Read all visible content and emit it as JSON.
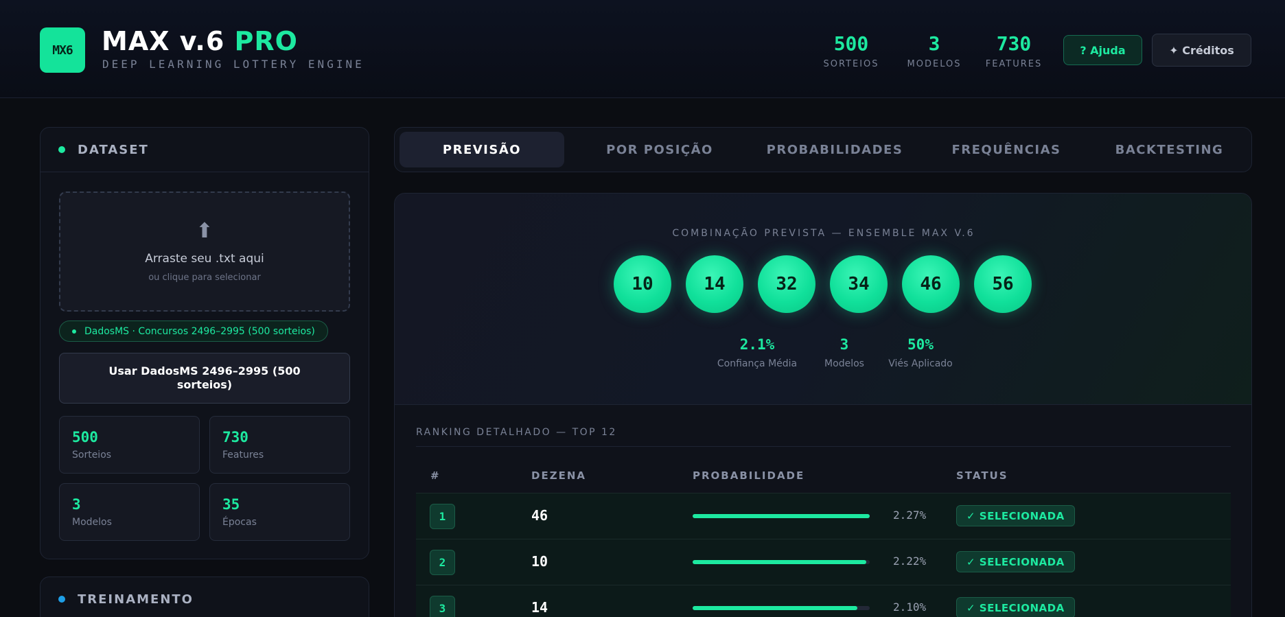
{
  "header": {
    "logo": "MX6",
    "title_main": "MAX v.6",
    "title_accent": "PRO",
    "subtitle": "DEEP LEARNING LOTTERY ENGINE",
    "stats": [
      {
        "value": "500",
        "label": "SORTEIOS"
      },
      {
        "value": "3",
        "label": "MODELOS"
      },
      {
        "value": "730",
        "label": "FEATURES"
      }
    ],
    "help_label": "? Ajuda",
    "credits_label": "✦ Créditos"
  },
  "dataset": {
    "title": "DATASET",
    "dropzone_icon": "upload-arrow-icon",
    "dropzone_title": "Arraste seu .txt aqui",
    "dropzone_sub": "ou clique para selecionar",
    "loaded_pill": "DadosMS · Concursos 2496–2995 (500 sorteios)",
    "use_button": "Usar DadosMS 2496–2995 (500 sorteios)",
    "mini_stats": [
      {
        "value": "500",
        "label": "Sorteios"
      },
      {
        "value": "730",
        "label": "Features"
      },
      {
        "value": "3",
        "label": "Modelos"
      },
      {
        "value": "35",
        "label": "Épocas"
      }
    ]
  },
  "training": {
    "title": "TREINAMENTO"
  },
  "tabs": [
    {
      "label": "PREVISÃO",
      "active": true
    },
    {
      "label": "POR POSIÇÃO",
      "active": false
    },
    {
      "label": "PROBABILIDADES",
      "active": false
    },
    {
      "label": "FREQUÊNCIAS",
      "active": false
    },
    {
      "label": "BACKTESTING",
      "active": false
    }
  ],
  "prediction": {
    "caption": "COMBINAÇÃO PREVISTA — ENSEMBLE MAX V.6",
    "numbers": [
      "10",
      "14",
      "32",
      "34",
      "46",
      "56"
    ],
    "stats": [
      {
        "value": "2.1%",
        "label": "Confiança Média"
      },
      {
        "value": "3",
        "label": "Modelos"
      },
      {
        "value": "50%",
        "label": "Viés Aplicado"
      }
    ]
  },
  "ranking": {
    "title": "RANKING DETALHADO — TOP 12",
    "columns": [
      "#",
      "DEZENA",
      "PROBABILIDADE",
      "STATUS"
    ],
    "rows": [
      {
        "rank": "1",
        "number": "46",
        "prob": "2.27%",
        "fill": 1.0,
        "status": "✓ SELECIONADA"
      },
      {
        "rank": "2",
        "number": "10",
        "prob": "2.22%",
        "fill": 0.98,
        "status": "✓ SELECIONADA"
      },
      {
        "rank": "3",
        "number": "14",
        "prob": "2.10%",
        "fill": 0.93,
        "status": "✓ SELECIONADA"
      }
    ]
  },
  "colors": {
    "accent": "#1de9a0",
    "background": "#0b0d12",
    "panel": "#0f121a",
    "training_dot": "#1e9ee6"
  }
}
